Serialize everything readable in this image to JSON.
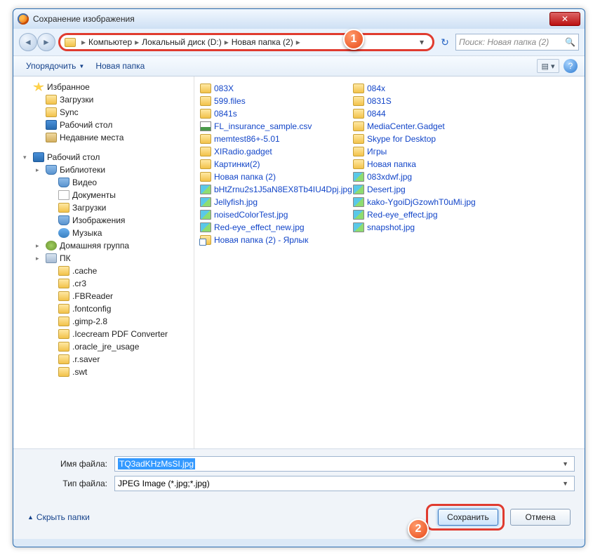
{
  "window": {
    "title": "Сохранение изображения"
  },
  "callouts": {
    "one": "1",
    "two": "2"
  },
  "nav": {
    "crumbs": [
      "Компьютер",
      "Локальный диск (D:)",
      "Новая папка (2)"
    ],
    "search_placeholder": "Поиск: Новая папка (2)"
  },
  "toolbar": {
    "organize": "Упорядочить",
    "newfolder": "Новая папка"
  },
  "sidebar": [
    {
      "label": "Избранное",
      "icon": "ico-fav",
      "indent": 0,
      "exp": ""
    },
    {
      "label": "Загрузки",
      "icon": "ico-fold",
      "indent": 1,
      "exp": ""
    },
    {
      "label": "Sync",
      "icon": "ico-fold",
      "indent": 1,
      "exp": ""
    },
    {
      "label": "Рабочий стол",
      "icon": "ico-desk",
      "indent": 1,
      "exp": ""
    },
    {
      "label": "Недавние места",
      "icon": "ico-rec",
      "indent": 1,
      "exp": ""
    },
    {
      "gap": true
    },
    {
      "label": "Рабочий стол",
      "icon": "ico-desk",
      "indent": 0,
      "exp": "▾"
    },
    {
      "label": "Библиотеки",
      "icon": "ico-lib",
      "indent": 1,
      "exp": "▸"
    },
    {
      "label": "Видео",
      "icon": "ico-lib",
      "indent": 2,
      "exp": ""
    },
    {
      "label": "Документы",
      "icon": "ico-doc",
      "indent": 2,
      "exp": ""
    },
    {
      "label": "Загрузки",
      "icon": "ico-fold",
      "indent": 2,
      "exp": ""
    },
    {
      "label": "Изображения",
      "icon": "ico-lib",
      "indent": 2,
      "exp": ""
    },
    {
      "label": "Музыка",
      "icon": "ico-mus",
      "indent": 2,
      "exp": ""
    },
    {
      "label": "Домашняя группа",
      "icon": "ico-grp",
      "indent": 1,
      "exp": "▸"
    },
    {
      "label": "ПК",
      "icon": "ico-pc",
      "indent": 1,
      "exp": "▸"
    },
    {
      "label": ".cache",
      "icon": "ico-fold",
      "indent": 2,
      "exp": ""
    },
    {
      "label": ".cr3",
      "icon": "ico-fold",
      "indent": 2,
      "exp": ""
    },
    {
      "label": ".FBReader",
      "icon": "ico-fold",
      "indent": 2,
      "exp": ""
    },
    {
      "label": ".fontconfig",
      "icon": "ico-fold",
      "indent": 2,
      "exp": ""
    },
    {
      "label": ".gimp-2.8",
      "icon": "ico-fold",
      "indent": 2,
      "exp": ""
    },
    {
      "label": ".Icecream PDF Converter",
      "icon": "ico-fold",
      "indent": 2,
      "exp": ""
    },
    {
      "label": ".oracle_jre_usage",
      "icon": "ico-fold",
      "indent": 2,
      "exp": ""
    },
    {
      "label": ".r.saver",
      "icon": "ico-fold",
      "indent": 2,
      "exp": ""
    },
    {
      "label": ".swt",
      "icon": "ico-fold",
      "indent": 2,
      "exp": ""
    }
  ],
  "files_col1": [
    {
      "name": "083X",
      "icon": "ico-fold"
    },
    {
      "name": "599.files",
      "icon": "ico-fold"
    },
    {
      "name": "0841s",
      "icon": "ico-fold"
    },
    {
      "name": "FL_insurance_sample.csv",
      "icon": "ico-csv"
    },
    {
      "name": "memtest86+-5.01",
      "icon": "ico-fold"
    },
    {
      "name": "XIRadio.gadget",
      "icon": "ico-fold"
    },
    {
      "name": "Картинки(2)",
      "icon": "ico-fold"
    },
    {
      "name": "Новая папка (2)",
      "icon": "ico-fold"
    },
    {
      "name": "bHtZrnu2s1J5aN8EX8Tb4IU4Dpj.jpg",
      "icon": "ico-img"
    },
    {
      "name": "Jellyfish.jpg",
      "icon": "ico-img"
    },
    {
      "name": "noisedColorTest.jpg",
      "icon": "ico-img"
    },
    {
      "name": "Red-eye_effect_new.jpg",
      "icon": "ico-img"
    },
    {
      "name": "Новая папка (2) - Ярлык",
      "icon": "ico-link"
    }
  ],
  "files_col2": [
    {
      "name": "084x",
      "icon": "ico-fold"
    },
    {
      "name": "0831S",
      "icon": "ico-fold"
    },
    {
      "name": "0844",
      "icon": "ico-fold"
    },
    {
      "name": "MediaCenter.Gadget",
      "icon": "ico-fold"
    },
    {
      "name": "Skype for Desktop",
      "icon": "ico-fold"
    },
    {
      "name": "Игры",
      "icon": "ico-fold"
    },
    {
      "name": "Новая папка",
      "icon": "ico-fold"
    },
    {
      "name": "083xdwf.jpg",
      "icon": "ico-img"
    },
    {
      "name": "Desert.jpg",
      "icon": "ico-img"
    },
    {
      "name": "kako-YgoiDjGzowhT0uMi.jpg",
      "icon": "ico-img"
    },
    {
      "name": "Red-eye_effect.jpg",
      "icon": "ico-img"
    },
    {
      "name": "snapshot.jpg",
      "icon": "ico-img"
    }
  ],
  "fields": {
    "filename_label": "Имя файла:",
    "filename_value": "TQ3adKHzMsSI.jpg",
    "filetype_label": "Тип файла:",
    "filetype_value": "JPEG Image (*.jpg;*.jpg)"
  },
  "actions": {
    "hide_folders": "Скрыть папки",
    "save": "Сохранить",
    "cancel": "Отмена"
  }
}
